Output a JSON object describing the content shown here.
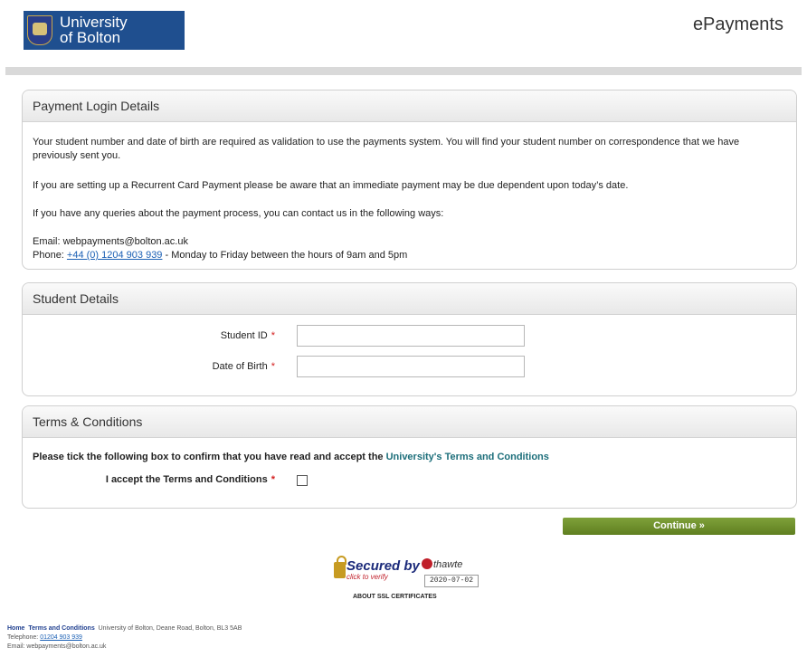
{
  "header": {
    "logo_line1": "University",
    "logo_line2": "of Bolton",
    "brand": "ePayments"
  },
  "login_panel": {
    "title": "Payment Login Details",
    "para1": "Your student number and date of birth are required as validation to use the payments system. You will find your student number on correspondence that we have previously sent you.",
    "para2": "If you are setting up a Recurrent Card Payment please be aware that an immediate payment may be due dependent upon today’s date.",
    "para3": "If you have any queries about the payment process, you can contact us in the following ways:",
    "email": "Email: webpayments@bolton.ac.uk",
    "phone_prefix": "Phone: ",
    "phone_link": "+44 (0) 1204 903 939",
    "phone_suffix": " - Monday to Friday between the hours of 9am and 5pm"
  },
  "student_panel": {
    "title": "Student Details",
    "student_id_label": "Student ID",
    "dob_label": "Date of Birth",
    "required_mark": "*",
    "student_id_value": "",
    "dob_value": ""
  },
  "terms_panel": {
    "title": "Terms & Conditions",
    "instruction": "Please tick the following box to confirm that you have read and accept the ",
    "terms_link": "University's Terms and Conditions",
    "accept_label": "I accept the Terms and Conditions",
    "checked": false
  },
  "continue_label": "Continue »",
  "seal": {
    "line1": "Secured by",
    "line2": "click to verify",
    "brand": "thawte",
    "date": "2020-07-02",
    "about": "ABOUT SSL CERTIFICATES"
  },
  "footer": {
    "home": "Home",
    "terms": "Terms and Conditions",
    "address": "University of Bolton, Deane Road, Bolton, BL3 5AB",
    "tel_prefix": "Telephone: ",
    "tel_link": "01204 903 939",
    "email": "Email: webpayments@bolton.ac.uk"
  },
  "colors": {
    "accent_green": "#6b8e23",
    "link_blue": "#1a5fb4",
    "required_red": "#d42020"
  }
}
